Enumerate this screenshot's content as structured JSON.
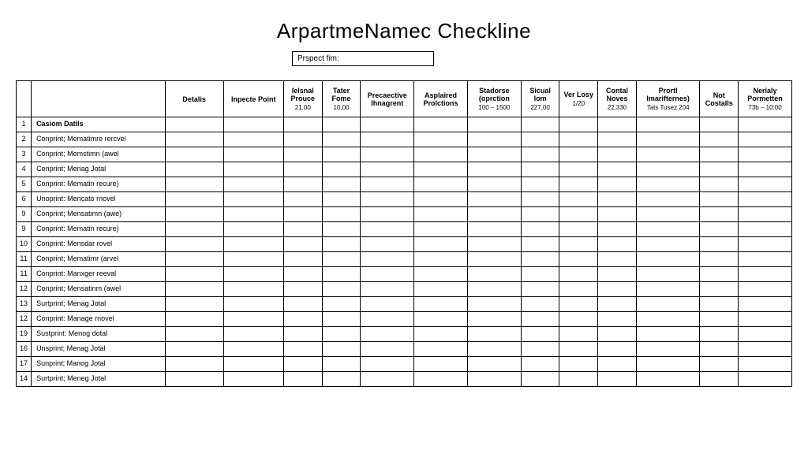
{
  "title": "ArpartmeNamec Checkline",
  "prospect_label": "Prspect fim:",
  "columns": [
    {
      "label": "",
      "sub": ""
    },
    {
      "label": "",
      "sub": ""
    },
    {
      "label": "Detalis",
      "sub": ""
    },
    {
      "label": "Inpecte Point",
      "sub": ""
    },
    {
      "label": "ſеlsnal Prouce",
      "sub": "21.00"
    },
    {
      "label": "Tater Fome",
      "sub": "10,00"
    },
    {
      "label": "Precaective Ihnagrent",
      "sub": ""
    },
    {
      "label": "Asplaired Prolctions",
      "sub": ""
    },
    {
      "label": "Stadorse (oprction",
      "sub": "100 – 1500"
    },
    {
      "label": "Sicual lom",
      "sub": "227,00"
    },
    {
      "label": "Ver Losy",
      "sub": "1/20"
    },
    {
      "label": "Contal Noves",
      "sub": "22,330"
    },
    {
      "label": "Prortl Imarifternes)",
      "sub": "Tats Tusez 204"
    },
    {
      "label": "Not Costalls",
      "sub": ""
    },
    {
      "label": "Nerialy Pormetten",
      "sub": "73b – 10:00"
    }
  ],
  "rows": [
    {
      "num": "1",
      "desc": "Casiom Datils",
      "section": true
    },
    {
      "num": "2",
      "desc": "Conprint; Mematimre rercvel"
    },
    {
      "num": "3",
      "desc": "Conprint; Memstimn (awel"
    },
    {
      "num": "4",
      "desc": "Conprint; Menag Jotal"
    },
    {
      "num": "5",
      "desc": "Conprint: Mematin recure)"
    },
    {
      "num": "6",
      "desc": "Unoprint: Mencato rnovel"
    },
    {
      "num": "9",
      "desc": "Conprint; Mensatimn (awe)"
    },
    {
      "num": "9",
      "desc": "Conprint: Mematin recure)"
    },
    {
      "num": "10",
      "desc": "Conprint: Mensdar rovel"
    },
    {
      "num": "11",
      "desc": "Conprint; Mematimr (arvel"
    },
    {
      "num": "11",
      "desc": "Conprint: Manxger reeval"
    },
    {
      "num": "12",
      "desc": "Conprint; Mensatinm (awel"
    },
    {
      "num": "13",
      "desc": "Surtprint; Menag Jotal"
    },
    {
      "num": "12",
      "desc": "Conprint: Manage rnovel"
    },
    {
      "num": "19",
      "desc": "Sustprint: Menog dotal"
    },
    {
      "num": "16",
      "desc": "Unsprint; Menag Jotal"
    },
    {
      "num": "17",
      "desc": "Sunprint; Manog Jotal"
    },
    {
      "num": "14",
      "desc": "Surtprint; Meneg Jotal"
    }
  ]
}
